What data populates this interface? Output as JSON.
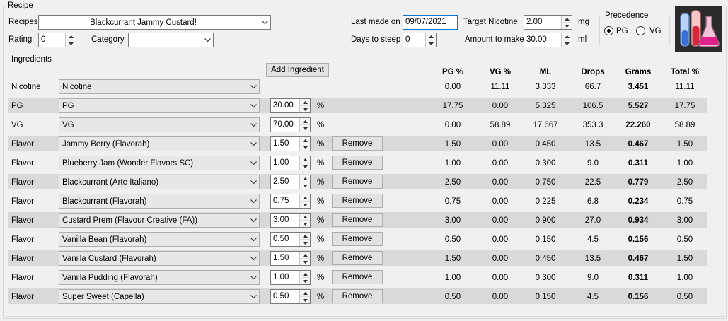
{
  "recipe_group": {
    "title": "Recipe",
    "recipes_label": "Recipes",
    "recipe_value": "Blackcurrant Jammy Custard!",
    "rating_label": "Rating",
    "rating_value": "0",
    "category_label": "Category",
    "category_value": "",
    "last_made_label": "Last made on",
    "last_made_value": "09/07/2021",
    "days_steep_label": "Days to steep",
    "days_steep_value": "0",
    "target_nic_label": "Target Nicotine",
    "target_nic_value": "2.00",
    "target_nic_unit": "mg",
    "amount_label": "Amount to make",
    "amount_value": "30.00",
    "amount_unit": "ml"
  },
  "precedence": {
    "title": "Precedence",
    "options": [
      "PG",
      "VG"
    ],
    "selected": "PG"
  },
  "ingredients": {
    "title": "Ingredients",
    "add_button": "Add Ingredient",
    "remove_label": "Remove",
    "percent_sign": "%",
    "headers": [
      "PG %",
      "VG %",
      "ML",
      "Drops",
      "Grams",
      "Total %"
    ],
    "rows": [
      {
        "type": "Nicotine",
        "name": "Nicotine",
        "pct": "",
        "pg": "0.00",
        "vg": "11.11",
        "ml": "3.333",
        "drops": "66.7",
        "grams": "3.451",
        "total": "11.11"
      },
      {
        "type": "PG",
        "name": "PG",
        "pct": "30.00",
        "pg": "17.75",
        "vg": "0.00",
        "ml": "5.325",
        "drops": "106.5",
        "grams": "5.527",
        "total": "17.75"
      },
      {
        "type": "VG",
        "name": "VG",
        "pct": "70.00",
        "pg": "0.00",
        "vg": "58.89",
        "ml": "17.667",
        "drops": "353.3",
        "grams": "22.260",
        "total": "58.89"
      },
      {
        "type": "Flavor",
        "name": "Jammy Berry (Flavorah)",
        "pct": "1.50",
        "pg": "1.50",
        "vg": "0.00",
        "ml": "0.450",
        "drops": "13.5",
        "grams": "0.467",
        "total": "1.50"
      },
      {
        "type": "Flavor",
        "name": "Blueberry Jam (Wonder Flavors SC)",
        "pct": "1.00",
        "pg": "1.00",
        "vg": "0.00",
        "ml": "0.300",
        "drops": "9.0",
        "grams": "0.311",
        "total": "1.00"
      },
      {
        "type": "Flavor",
        "name": "Blackcurrant (Arte Italiano)",
        "pct": "2.50",
        "pg": "2.50",
        "vg": "0.00",
        "ml": "0.750",
        "drops": "22.5",
        "grams": "0.779",
        "total": "2.50"
      },
      {
        "type": "Flavor",
        "name": "Blackcurrant (Flavorah)",
        "pct": "0.75",
        "pg": "0.75",
        "vg": "0.00",
        "ml": "0.225",
        "drops": "6.8",
        "grams": "0.234",
        "total": "0.75"
      },
      {
        "type": "Flavor",
        "name": "Custard Prem (Flavour Creative (FA))",
        "pct": "3.00",
        "pg": "3.00",
        "vg": "0.00",
        "ml": "0.900",
        "drops": "27.0",
        "grams": "0.934",
        "total": "3.00"
      },
      {
        "type": "Flavor",
        "name": "Vanilla Bean (Flavorah)",
        "pct": "0.50",
        "pg": "0.50",
        "vg": "0.00",
        "ml": "0.150",
        "drops": "4.5",
        "grams": "0.156",
        "total": "0.50"
      },
      {
        "type": "Flavor",
        "name": "Vanilla Custard (Flavorah)",
        "pct": "1.50",
        "pg": "1.50",
        "vg": "0.00",
        "ml": "0.450",
        "drops": "13.5",
        "grams": "0.467",
        "total": "1.50"
      },
      {
        "type": "Flavor",
        "name": "Vanilla Pudding (Flavorah)",
        "pct": "1.00",
        "pg": "1.00",
        "vg": "0.00",
        "ml": "0.300",
        "drops": "9.0",
        "grams": "0.311",
        "total": "1.00"
      },
      {
        "type": "Flavor",
        "name": "Super Sweet (Capella)",
        "pct": "0.50",
        "pg": "0.50",
        "vg": "0.00",
        "ml": "0.150",
        "drops": "4.5",
        "grams": "0.156",
        "total": "0.50"
      }
    ]
  },
  "logo_icon": "lab-flasks-icon"
}
